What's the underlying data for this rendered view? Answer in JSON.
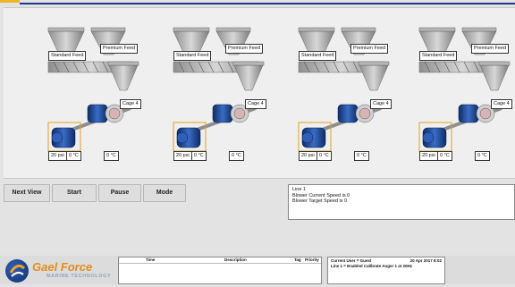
{
  "hmi": {
    "units": [
      {
        "standard_feed": "Standard Feed",
        "premium_feed": "Premium Feed",
        "cage": "Cage 4",
        "pressure": "20 psi",
        "temp1": "0 °C",
        "temp2": "0 °C"
      },
      {
        "standard_feed": "Standard Feed",
        "premium_feed": "Premium Feed",
        "cage": "Cage 4",
        "pressure": "20 psi",
        "temp1": "0 °C",
        "temp2": "0 °C"
      },
      {
        "standard_feed": "Standard Feed",
        "premium_feed": "Premium Feed",
        "cage": "Cage 4",
        "pressure": "20 psi",
        "temp1": "0 °C",
        "temp2": "0 °C"
      },
      {
        "standard_feed": "Standard Feed",
        "premium_feed": "Premium Feed",
        "cage": "Cage 4",
        "pressure": "20 psi",
        "temp1": "0 °C",
        "temp2": "0 °C"
      }
    ]
  },
  "buttons": {
    "next_view": "Next View",
    "start": "Start",
    "pause": "Pause",
    "mode": "Mode"
  },
  "messages": {
    "line1": "Line 1",
    "line2": "Blower Current Speed is 0",
    "line3": "Blower Target Speed is 0"
  },
  "logo": {
    "name": "Gael Force",
    "subtitle": "MARINE TECHNOLOGY"
  },
  "alarm_table": {
    "headers": {
      "time": "Time",
      "description": "Description",
      "tag": "Tag",
      "priority": "Priority"
    }
  },
  "user_panel": {
    "current_user": "Current User = Guest",
    "date": "20 Apr 2017 8:02",
    "event": "Line 1 = Enabled Calibrate Auger 1 at 20Hz"
  },
  "colors": {
    "accent": "#f0b429",
    "nav_line": "#1f3a8a",
    "logo_orange": "#e58b1a",
    "logo_blue": "#1d4a9a",
    "motor_blue": "#1c3f8f"
  }
}
